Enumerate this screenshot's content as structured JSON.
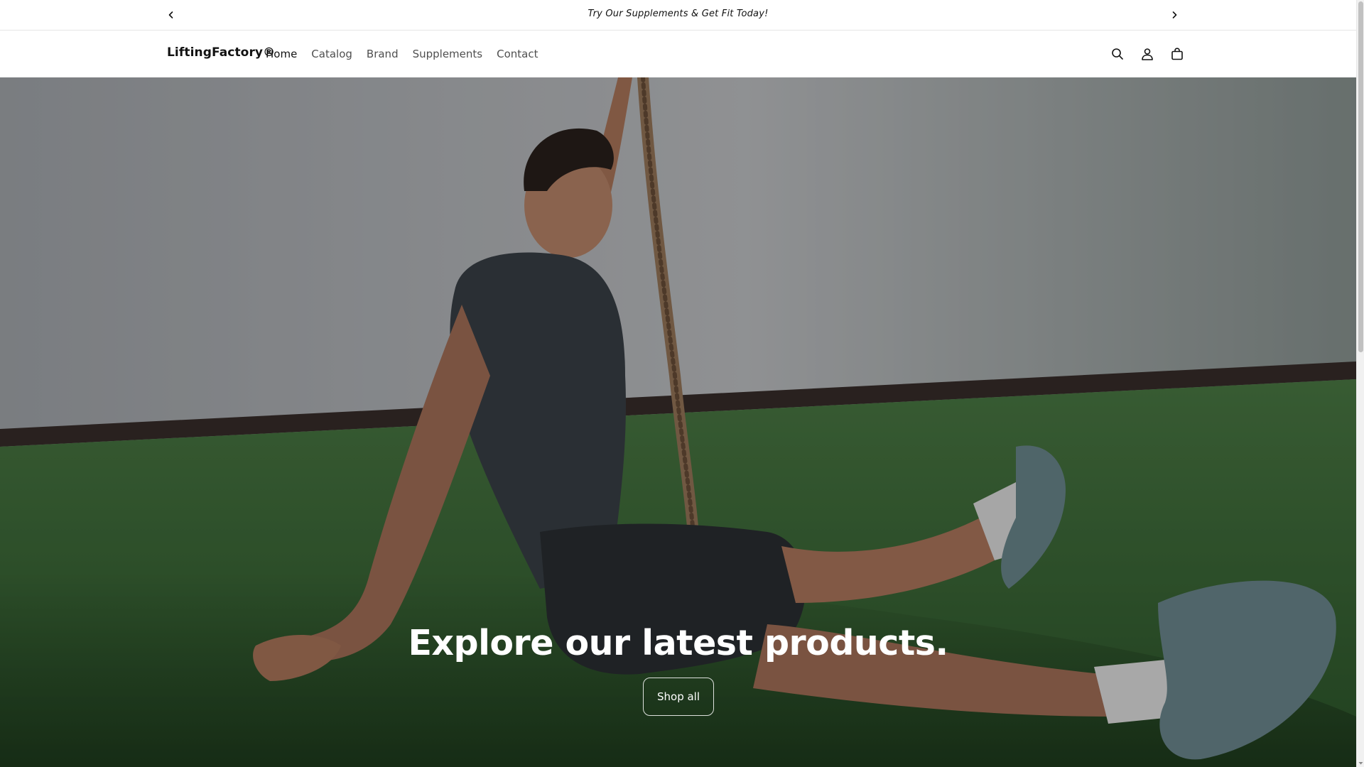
{
  "announcement": {
    "text": "Try Our Supplements & Get Fit Today!",
    "prev_icon": "chevron-left-icon",
    "next_icon": "chevron-right-icon"
  },
  "header": {
    "logo": "LiftingFactory®",
    "nav": [
      {
        "label": "Home",
        "active": true
      },
      {
        "label": "Catalog",
        "active": false
      },
      {
        "label": "Brand",
        "active": false
      },
      {
        "label": "Supplements",
        "active": false
      },
      {
        "label": "Contact",
        "active": false
      }
    ],
    "icons": [
      "search-icon",
      "account-icon",
      "cart-icon"
    ]
  },
  "hero": {
    "heading": "Explore our latest products.",
    "button_label": "Shop all"
  },
  "colors": {
    "text": "#121212",
    "hero_text": "#ffffff",
    "turf_green": "#3f6e3a",
    "wall_gray": "#b9bcbf"
  }
}
